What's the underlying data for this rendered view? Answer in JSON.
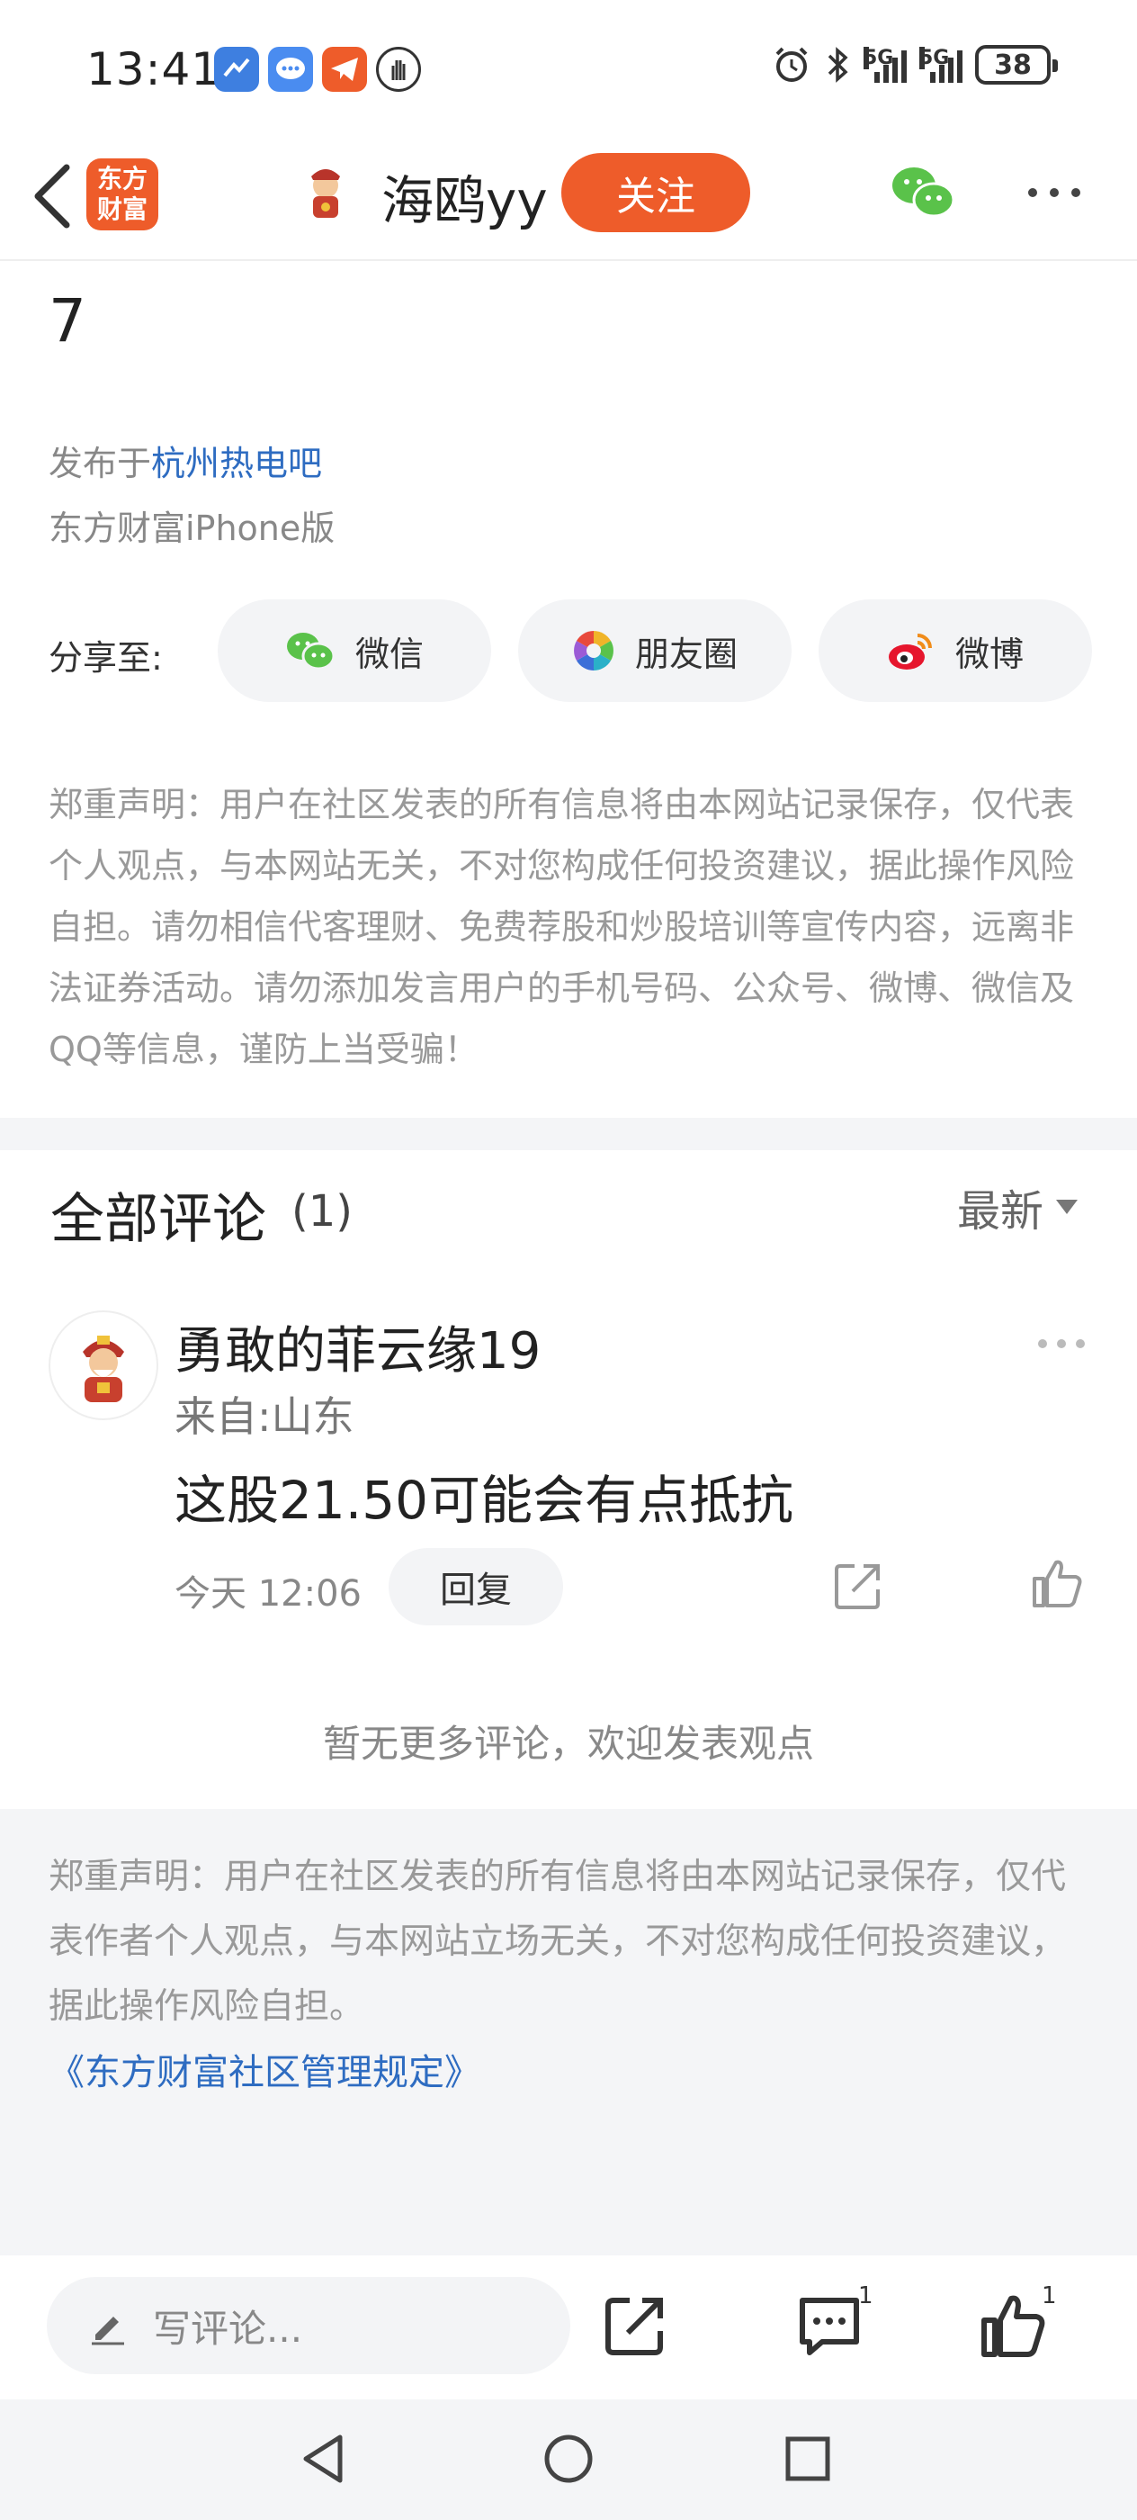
{
  "status_bar": {
    "time": "13:41",
    "signal1_label": "5G",
    "signal2_label": "5G",
    "battery": "38"
  },
  "header": {
    "logo_line1": "东方",
    "logo_line2": "财富",
    "author": "海鸥yy",
    "follow_label": "关注"
  },
  "post": {
    "tail_text": "7",
    "published_prefix": "发布于",
    "published_bar": "杭州热电吧",
    "client": "东方财富iPhone版"
  },
  "share": {
    "label": "分享至:",
    "wechat": "微信",
    "moments": "朋友圈",
    "weibo": "微博"
  },
  "disclaimer_top": "郑重声明：用户在社区发表的所有信息将由本网站记录保存，仅代表个人观点，与本网站无关，不对您构成任何投资建议，据此操作风险自担。请勿相信代客理财、免费荐股和炒股培训等宣传内容，远离非法证券活动。请勿添加发言用户的手机号码、公众号、微博、微信及QQ等信息，谨防上当受骗！",
  "comments": {
    "title": "全部评论",
    "count": "(1)",
    "sort_label": "最新",
    "items": [
      {
        "name": "勇敢的菲云缘19",
        "from": "来自:山东",
        "text": "这股21.50可能会有点抵抗",
        "time": "今天 12:06",
        "reply_label": "回复"
      }
    ],
    "no_more": "暂无更多评论，欢迎发表观点"
  },
  "footer": {
    "disclaimer": "郑重声明：用户在社区发表的所有信息将由本网站记录保存，仅代表作者个人观点，与本网站立场无关，不对您构成任何投资建议，据此操作风险自担。",
    "rules_link": "《东方财富社区管理规定》"
  },
  "toolbar": {
    "comment_placeholder": "写评论...",
    "comment_count": "1",
    "like_count": "1"
  },
  "colors": {
    "accent": "#ee5c2a",
    "link": "#2e6cc1",
    "wechat_green": "#5ac24a"
  }
}
